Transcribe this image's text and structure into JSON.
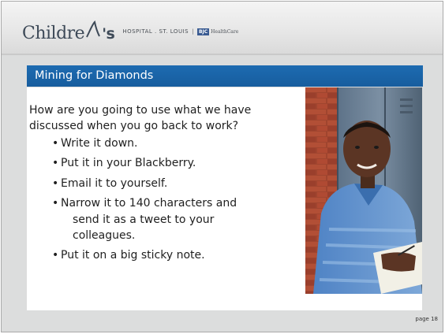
{
  "header": {
    "logo_word_left": "Childre",
    "logo_word_right": "'s",
    "logo_sub_left": "HOSPITAL . ST. LOUIS",
    "logo_sub_sep": "|",
    "badge": "BJC",
    "healthcare": "HealthCare"
  },
  "slide": {
    "title": "Mining for Diamonds",
    "question_line1": "How are you going to use what we have",
    "question_line2": "discussed when you go back to work?",
    "bullets": [
      "Write it down.",
      "Put it in your Blackberry.",
      "Email it to yourself.",
      "Narrow it to 140 characters and",
      "Put it on a big sticky note."
    ],
    "bullet_wrap_line2": "send it as a tweet to your",
    "bullet_wrap_line3": "colleagues.",
    "page_label": "page 18"
  },
  "colors": {
    "title_bar": "#1d6bb1",
    "slide_bg": "#dcdddd",
    "logo_text": "#3e4a58",
    "bjc_badge": "#3a5b92"
  }
}
